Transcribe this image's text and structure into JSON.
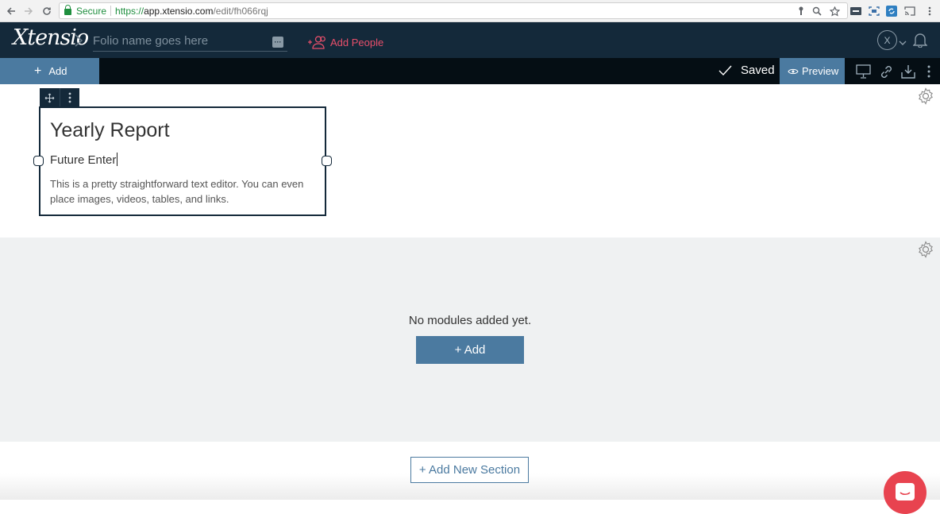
{
  "browser": {
    "secure_label": "Secure",
    "url_scheme": "https://",
    "url_host": "app.xtensio.com",
    "url_path": "/edit/fh066rqj"
  },
  "app": {
    "logo_text": "Xtensio",
    "folio_placeholder": "Folio name goes here",
    "add_people_label": "Add People",
    "avatar_initial": "X"
  },
  "toolbar": {
    "add_label": "Add",
    "saved_label": "Saved",
    "preview_label": "Preview"
  },
  "module": {
    "title": "Yearly Report",
    "subtitle": "Future Enter",
    "body": "This is a pretty straightforward text editor. You can even place images, videos, tables, and links."
  },
  "section_empty": {
    "message": "No modules added yet.",
    "add_label": "+ Add"
  },
  "footer": {
    "add_section_label": "+ Add New Section"
  },
  "colors": {
    "nav_dark": "#14293a",
    "toolbar_black": "#050e14",
    "accent_blue": "#4b7aa0",
    "add_people_pink": "#e84f6b",
    "chat_red": "#e8434f",
    "section_gray": "#eff1f2"
  }
}
